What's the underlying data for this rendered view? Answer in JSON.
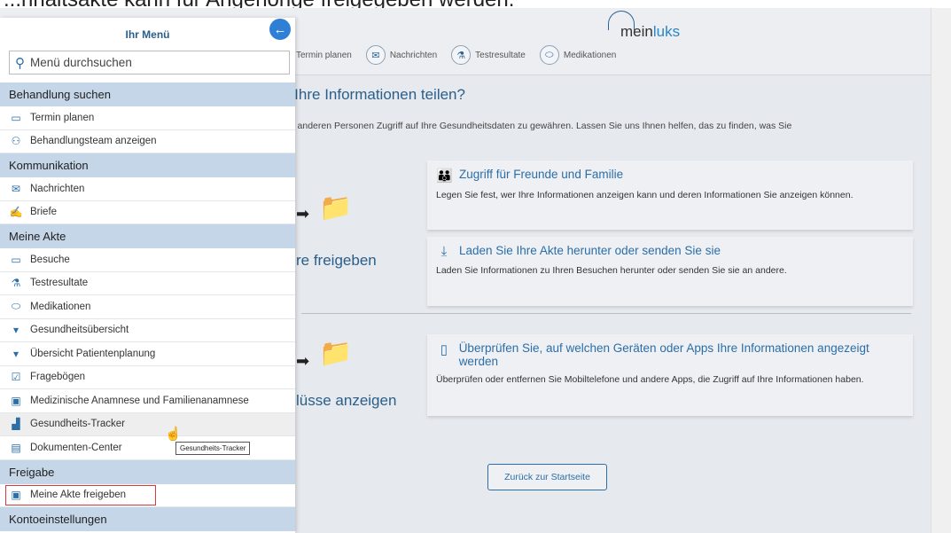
{
  "caption": "...nhaltsakte kann für Angehörige freigegeben werden.",
  "app": {
    "logo_prefix": "mein",
    "logo_suffix": "luks",
    "nav": [
      {
        "label": "Termin planen",
        "icon": "calendar-icon"
      },
      {
        "label": "Nachrichten",
        "icon": "envelope-icon"
      },
      {
        "label": "Testresultate",
        "icon": "flask-icon"
      },
      {
        "label": "Medikationen",
        "icon": "pills-icon"
      }
    ],
    "page_title": "e Ihre Informationen teilen?",
    "page_intro": "en, anderen Personen Zugriff auf Ihre Gesundheitsdaten zu gewähren. Lassen Sie uns Ihnen helfen, das zu finden, was Sie",
    "side_label_1": "re freigeben",
    "side_label_2": "lüsse anzeigen",
    "cards": [
      {
        "title": "Zugriff für Freunde und Familie",
        "text": "Legen Sie fest, wer Ihre Informationen anzeigen kann und deren Informationen Sie anzeigen können.",
        "icon": "family-icon"
      },
      {
        "title": "Laden Sie Ihre Akte herunter oder senden Sie sie",
        "text": "Laden Sie Informationen zu Ihren Besuchen herunter oder senden Sie sie an andere.",
        "icon": "download-icon"
      },
      {
        "title": "Überprüfen Sie, auf welchen Geräten oder Apps Ihre Informationen angezeigt werden",
        "text": "Überprüfen oder entfernen Sie Mobiltelefone und andere Apps, die Zugriff auf Ihre Informationen haben.",
        "icon": "phone-icon"
      }
    ],
    "back_button": "Zurück zur Startseite"
  },
  "menu": {
    "title": "Ihr Menü",
    "search_placeholder": "Menü durchsuchen",
    "sections": [
      {
        "label": "Behandlung suchen",
        "items": [
          {
            "label": "Termin planen",
            "icon": "calendar-icon"
          },
          {
            "label": "Behandlungsteam anzeigen",
            "icon": "team-icon"
          }
        ]
      },
      {
        "label": "Kommunikation",
        "items": [
          {
            "label": "Nachrichten",
            "icon": "envelope-icon"
          },
          {
            "label": "Briefe",
            "icon": "letter-icon"
          }
        ]
      },
      {
        "label": "Meine Akte",
        "items": [
          {
            "label": "Besuche",
            "icon": "calendar-icon"
          },
          {
            "label": "Testresultate",
            "icon": "flask-icon"
          },
          {
            "label": "Medikationen",
            "icon": "pills-icon"
          },
          {
            "label": "Gesundheitsübersicht",
            "icon": "summary-icon"
          },
          {
            "label": "Übersicht Patientenplanung",
            "icon": "summary-icon"
          },
          {
            "label": "Fragebögen",
            "icon": "checklist-icon"
          },
          {
            "label": "Medizinische Anamnese und Familienanamnese",
            "icon": "history-icon"
          },
          {
            "label": "Gesundheits-Tracker",
            "icon": "chart-icon"
          },
          {
            "label": "Dokumenten-Center",
            "icon": "document-icon"
          }
        ]
      },
      {
        "label": "Freigabe",
        "items": [
          {
            "label": "Meine Akte freigeben",
            "icon": "share-folder-icon"
          }
        ]
      },
      {
        "label": "Kontoeinstellungen",
        "items": []
      }
    ]
  },
  "tooltip": "Gesundheits-Tracker"
}
